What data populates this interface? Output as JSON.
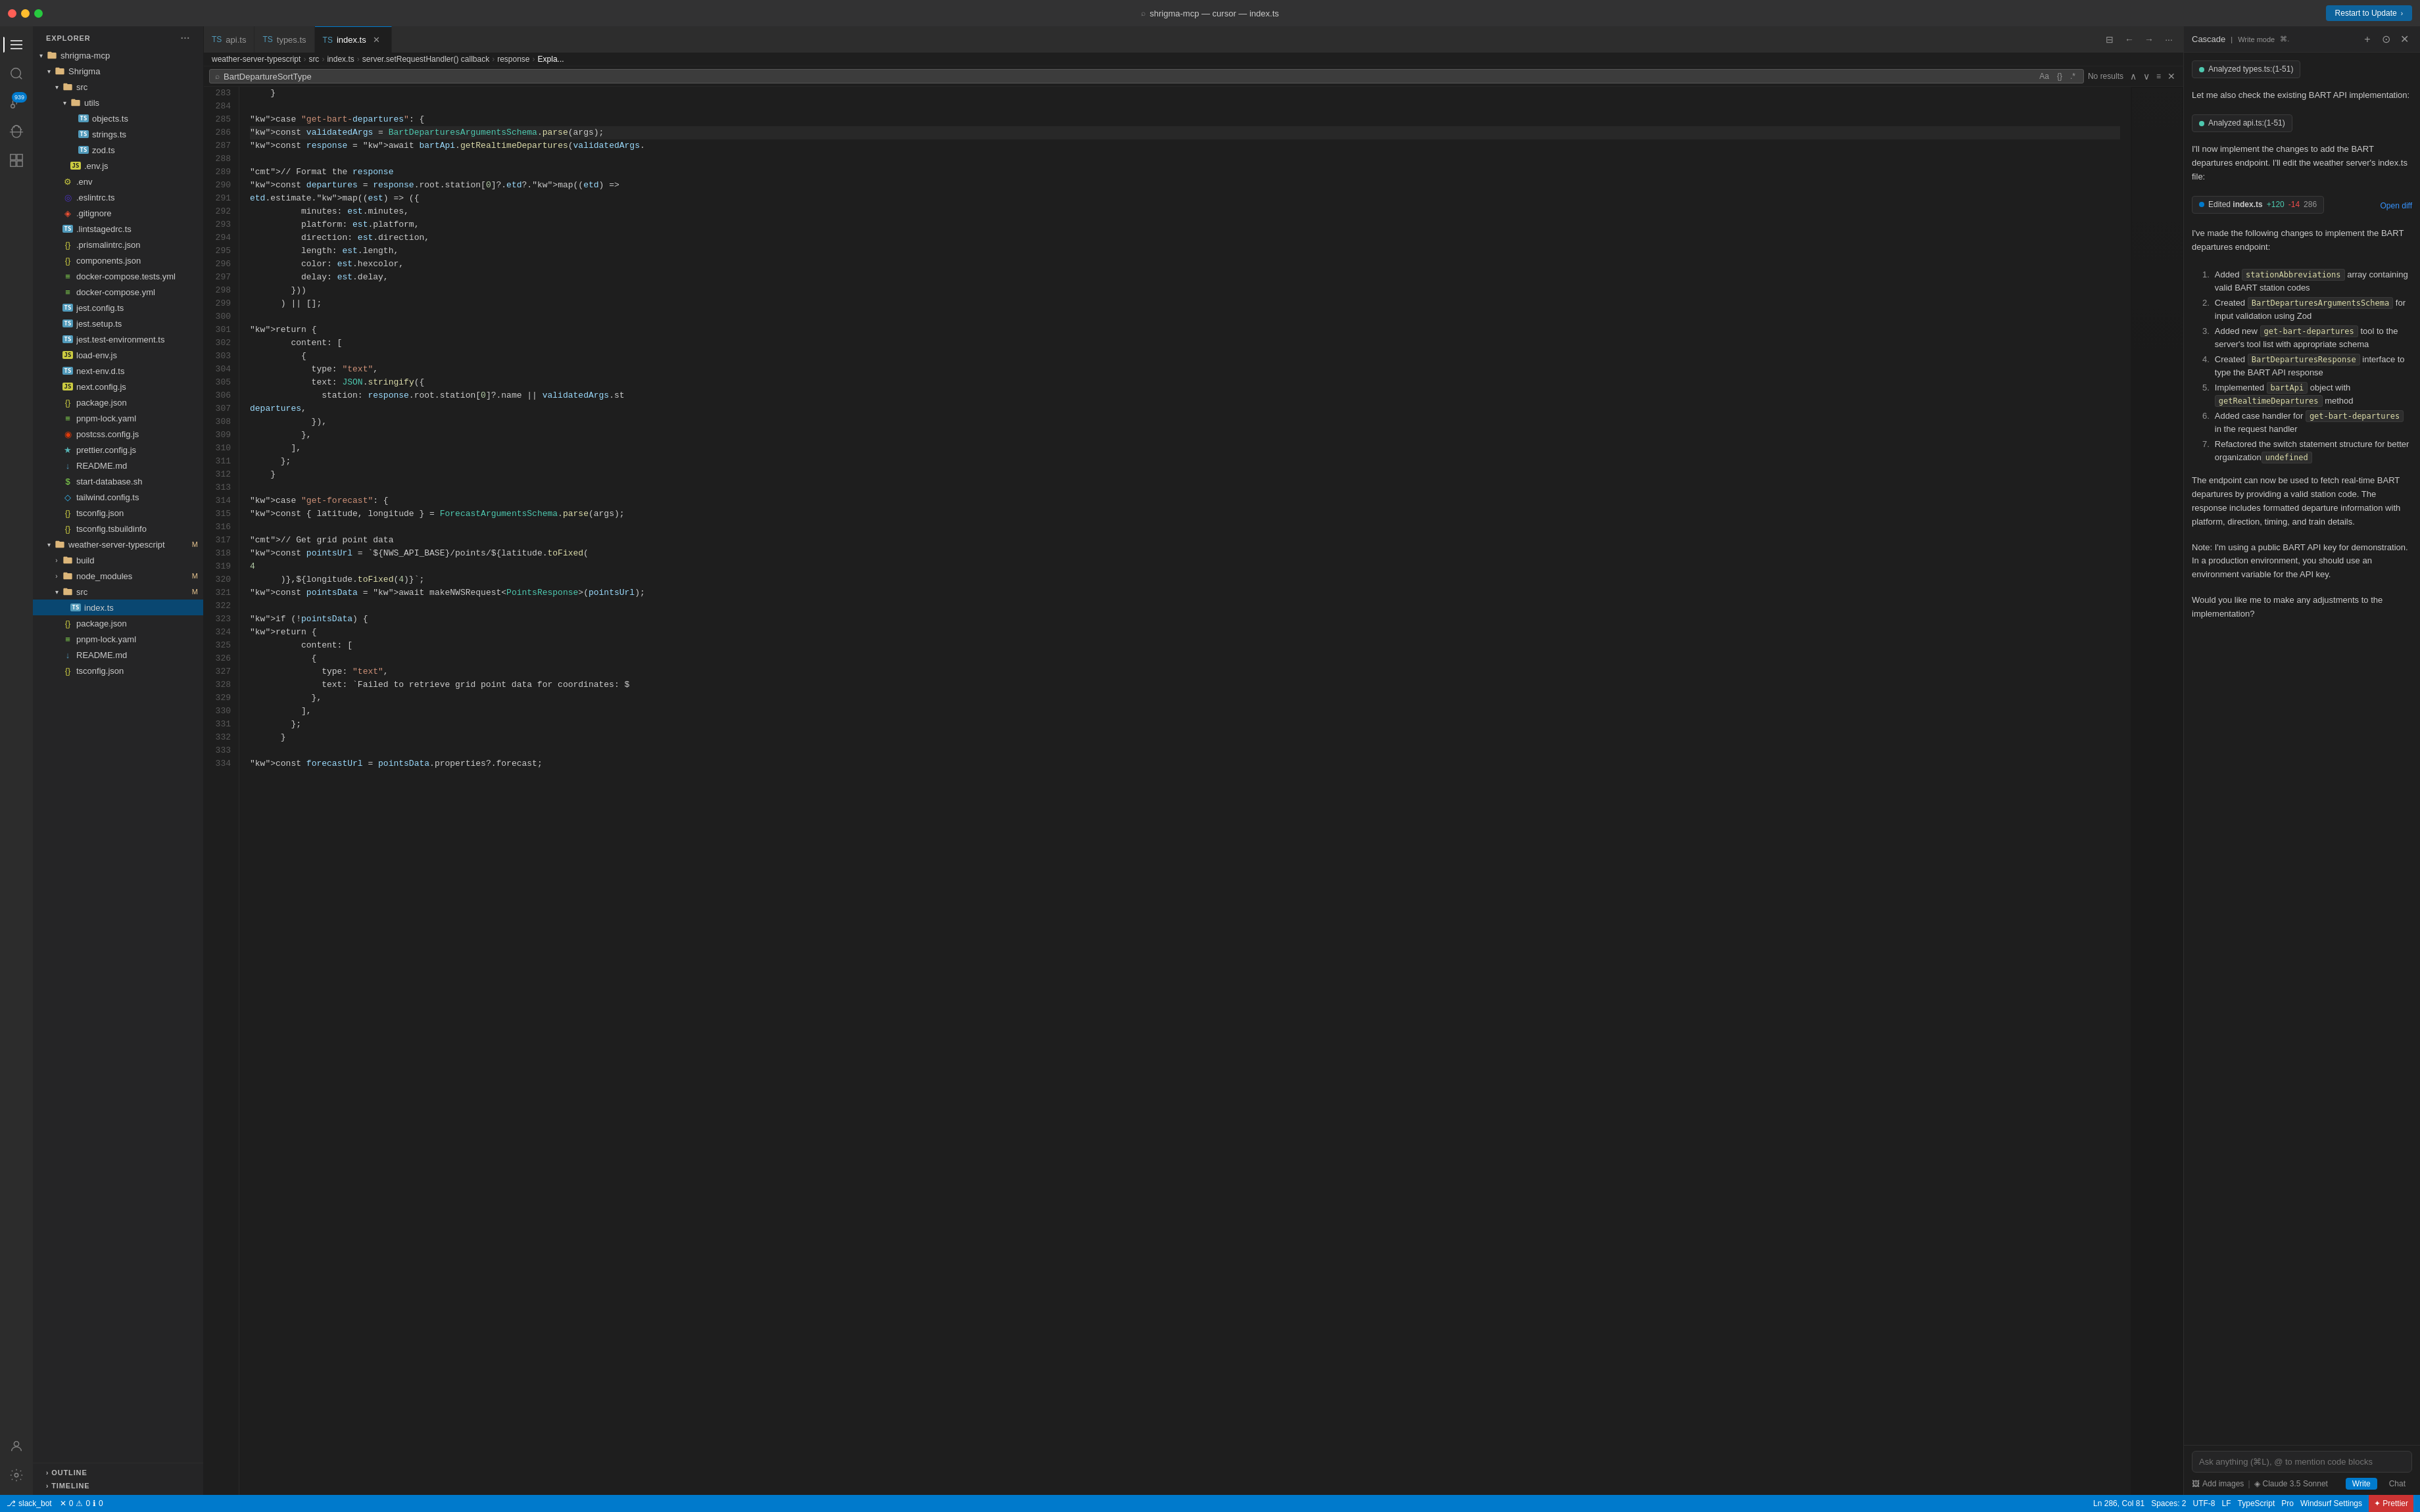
{
  "titleBar": {
    "title": "shrigma-mcp — cursor — index.ts",
    "restartBtn": "Restart to Update"
  },
  "activityBar": {
    "icons": [
      {
        "name": "explorer-icon",
        "symbol": "⎘",
        "active": true
      },
      {
        "name": "search-icon",
        "symbol": "🔍",
        "active": false
      },
      {
        "name": "source-control-icon",
        "symbol": "⎇",
        "active": false,
        "badge": "939"
      },
      {
        "name": "debug-icon",
        "symbol": "▷",
        "active": false
      },
      {
        "name": "extensions-icon",
        "symbol": "⊞",
        "active": false
      },
      {
        "name": "accounts-icon",
        "symbol": "◯",
        "active": false,
        "bottom": true
      },
      {
        "name": "settings-icon",
        "symbol": "⚙",
        "active": false,
        "bottom": true
      }
    ]
  },
  "sidebar": {
    "header": "Explorer",
    "tree": [
      {
        "level": 0,
        "label": "shrigma-mcp",
        "type": "folder",
        "open": true,
        "indent": 0
      },
      {
        "level": 1,
        "label": "Shrigma",
        "type": "folder",
        "open": true,
        "indent": 1
      },
      {
        "level": 2,
        "label": "src",
        "type": "folder-src",
        "open": true,
        "indent": 2
      },
      {
        "level": 3,
        "label": "utils",
        "type": "folder",
        "open": true,
        "indent": 3
      },
      {
        "level": 4,
        "label": "objects.ts",
        "type": "ts",
        "indent": 4
      },
      {
        "level": 4,
        "label": "strings.ts",
        "type": "ts",
        "indent": 4
      },
      {
        "level": 4,
        "label": "zod.ts",
        "type": "ts",
        "indent": 4
      },
      {
        "level": 3,
        "label": ".env.js",
        "type": "js",
        "indent": 3
      },
      {
        "level": 2,
        "label": ".env",
        "type": "env",
        "indent": 2
      },
      {
        "level": 2,
        "label": ".eslintrc.ts",
        "type": "eslint",
        "indent": 2
      },
      {
        "level": 2,
        "label": ".gitignore",
        "type": "git",
        "indent": 2
      },
      {
        "level": 2,
        "label": ".lintstagedrc.ts",
        "type": "ts",
        "indent": 2
      },
      {
        "level": 2,
        "label": ".prismalintrc.json",
        "type": "json",
        "indent": 2
      },
      {
        "level": 2,
        "label": "components.json",
        "type": "json",
        "indent": 2
      },
      {
        "level": 2,
        "label": "docker-compose.tests.yml",
        "type": "yaml",
        "indent": 2
      },
      {
        "level": 2,
        "label": "docker-compose.yml",
        "type": "yaml",
        "indent": 2
      },
      {
        "level": 2,
        "label": "jest.config.ts",
        "type": "ts",
        "indent": 2
      },
      {
        "level": 2,
        "label": "jest.setup.ts",
        "type": "ts",
        "indent": 2
      },
      {
        "level": 2,
        "label": "jest.test-environment.ts",
        "type": "ts",
        "indent": 2
      },
      {
        "level": 2,
        "label": "load-env.js",
        "type": "js",
        "indent": 2
      },
      {
        "level": 2,
        "label": "next-env.d.ts",
        "type": "ts",
        "indent": 2
      },
      {
        "level": 2,
        "label": "next.config.js",
        "type": "js",
        "indent": 2
      },
      {
        "level": 2,
        "label": "package.json",
        "type": "json",
        "indent": 2
      },
      {
        "level": 2,
        "label": "pnpm-lock.yaml",
        "type": "yaml",
        "indent": 2
      },
      {
        "level": 2,
        "label": "postcss.config.js",
        "type": "postcss",
        "indent": 2
      },
      {
        "level": 2,
        "label": "prettier.config.js",
        "type": "prettier",
        "indent": 2
      },
      {
        "level": 2,
        "label": "README.md",
        "type": "md",
        "indent": 2
      },
      {
        "level": 2,
        "label": "start-database.sh",
        "type": "sh",
        "indent": 2
      },
      {
        "level": 2,
        "label": "tailwind.config.ts",
        "type": "tailwind",
        "indent": 2
      },
      {
        "level": 2,
        "label": "tsconfig.json",
        "type": "json",
        "indent": 2
      },
      {
        "level": 2,
        "label": "tsconfig.tsbuildinfo",
        "type": "json",
        "indent": 2
      },
      {
        "level": 1,
        "label": "weather-server-typescript",
        "type": "folder",
        "open": true,
        "indent": 1,
        "gitBadge": "M",
        "gitBadgeType": "orange"
      },
      {
        "level": 2,
        "label": "build",
        "type": "folder",
        "open": false,
        "indent": 2
      },
      {
        "level": 2,
        "label": "node_modules",
        "type": "folder",
        "open": false,
        "indent": 2,
        "gitBadge": "M",
        "gitBadgeType": "orange"
      },
      {
        "level": 2,
        "label": "src",
        "type": "folder-src",
        "open": true,
        "indent": 2,
        "gitBadge": "M",
        "gitBadgeType": "orange"
      },
      {
        "level": 3,
        "label": "index.ts",
        "type": "ts",
        "indent": 3,
        "selected": true
      },
      {
        "level": 2,
        "label": "package.json",
        "type": "json",
        "indent": 2
      },
      {
        "level": 2,
        "label": "pnpm-lock.yaml",
        "type": "yaml",
        "indent": 2
      },
      {
        "level": 2,
        "label": "README.md",
        "type": "md",
        "indent": 2
      },
      {
        "level": 2,
        "label": "tsconfig.json",
        "type": "json",
        "indent": 2
      }
    ],
    "outlineLabel": "Outline",
    "timelineLabel": "Timeline"
  },
  "tabs": [
    {
      "label": "api.ts",
      "type": "ts",
      "active": false,
      "modified": false
    },
    {
      "label": "types.ts",
      "type": "ts",
      "active": false,
      "modified": false
    },
    {
      "label": "index.ts",
      "type": "ts",
      "active": true,
      "modified": false
    }
  ],
  "breadcrumb": {
    "items": [
      "weather-server-typescript",
      "src",
      "index.ts",
      "server.setRequestHandler() callback",
      "response",
      "Expla..."
    ]
  },
  "searchBar": {
    "value": "BartDepartureSortType",
    "noResults": "No results",
    "options": [
      "Aa",
      "{}",
      ".*"
    ]
  },
  "codeLines": [
    {
      "num": 283,
      "content": "    }"
    },
    {
      "num": 284,
      "content": ""
    },
    {
      "num": 285,
      "content": "    case \"get-bart-departures\": {"
    },
    {
      "num": 286,
      "content": "      const validatedArgs = BartDeparturesArgumentsSchema.parse(args);"
    },
    {
      "num": 287,
      "content": "      const response = await bartApi.getRealtimeDepartures(validatedArgs."
    },
    {
      "num": 288,
      "content": ""
    },
    {
      "num": 289,
      "content": "      // Format the response"
    },
    {
      "num": 290,
      "content": "      const departures = response.root.station[0]?.etd?.map((etd) =>"
    },
    {
      "num": 291,
      "content": "        etd.estimate.map((est) => ({"
    },
    {
      "num": 292,
      "content": "          minutes: est.minutes,"
    },
    {
      "num": 293,
      "content": "          platform: est.platform,"
    },
    {
      "num": 294,
      "content": "          direction: est.direction,"
    },
    {
      "num": 295,
      "content": "          length: est.length,"
    },
    {
      "num": 296,
      "content": "          color: est.hexcolor,"
    },
    {
      "num": 297,
      "content": "          delay: est.delay,"
    },
    {
      "num": 298,
      "content": "        }))"
    },
    {
      "num": 299,
      "content": "      ) || [];"
    },
    {
      "num": 300,
      "content": ""
    },
    {
      "num": 301,
      "content": "      return {"
    },
    {
      "num": 302,
      "content": "        content: ["
    },
    {
      "num": 303,
      "content": "          {"
    },
    {
      "num": 304,
      "content": "            type: \"text\","
    },
    {
      "num": 305,
      "content": "            text: JSON.stringify({"
    },
    {
      "num": 306,
      "content": "              station: response.root.station[0]?.name || validatedArgs.st"
    },
    {
      "num": 307,
      "content": "              departures,"
    },
    {
      "num": 308,
      "content": "            }),"
    },
    {
      "num": 309,
      "content": "          },"
    },
    {
      "num": 310,
      "content": "        ],"
    },
    {
      "num": 311,
      "content": "      };"
    },
    {
      "num": 312,
      "content": "    }"
    },
    {
      "num": 313,
      "content": ""
    },
    {
      "num": 314,
      "content": "    case \"get-forecast\": {"
    },
    {
      "num": 315,
      "content": "      const { latitude, longitude } = ForecastArgumentsSchema.parse(args);"
    },
    {
      "num": 316,
      "content": ""
    },
    {
      "num": 317,
      "content": "      // Get grid point data"
    },
    {
      "num": 318,
      "content": "      const pointsUrl = `${NWS_API_BASE}/points/${latitude.toFixed("
    },
    {
      "num": 319,
      "content": "        4"
    },
    {
      "num": 320,
      "content": "      )},${longitude.toFixed(4)}`;"
    },
    {
      "num": 321,
      "content": "      const pointsData = await makeNWSRequest<PointsResponse>(pointsUrl);"
    },
    {
      "num": 322,
      "content": ""
    },
    {
      "num": 323,
      "content": "      if (!pointsData) {"
    },
    {
      "num": 324,
      "content": "        return {"
    },
    {
      "num": 325,
      "content": "          content: ["
    },
    {
      "num": 326,
      "content": "            {"
    },
    {
      "num": 327,
      "content": "              type: \"text\","
    },
    {
      "num": 328,
      "content": "              text: `Failed to retrieve grid point data for coordinates: $"
    },
    {
      "num": 329,
      "content": "            },"
    },
    {
      "num": 330,
      "content": "          ],"
    },
    {
      "num": 331,
      "content": "        };"
    },
    {
      "num": 332,
      "content": "      }"
    },
    {
      "num": 333,
      "content": ""
    },
    {
      "num": 334,
      "content": "      const forecastUrl = pointsData.properties?.forecast;"
    }
  ],
  "chat": {
    "header": {
      "title": "Cascade",
      "mode": "Write mode",
      "shortcut": "⌘."
    },
    "messages": [
      {
        "type": "analyzed",
        "label": "Analyzed  types.ts:(1-51)"
      },
      {
        "type": "text",
        "content": "Let me also check the existing BART API implementation:"
      },
      {
        "type": "analyzed",
        "label": "Analyzed  api.ts:(1-51)"
      },
      {
        "type": "text",
        "content": "I'll now implement the changes to add the BART departures endpoint. I'll edit the weather server's index.ts file:"
      },
      {
        "type": "edited",
        "file": "index.ts",
        "add": "+120",
        "del": "-14",
        "total": "286",
        "openDiff": "Open diff"
      },
      {
        "type": "text",
        "content": "I've made the following changes to implement the BART departures endpoint:"
      },
      {
        "type": "list",
        "items": [
          {
            "num": "1.",
            "text": "Added ",
            "code": "stationAbbreviations",
            "rest": " array containing valid BART station codes"
          },
          {
            "num": "2.",
            "text": "Created ",
            "code": "BartDeparturesArgumentsSchema",
            "rest": " for input validation using Zod"
          },
          {
            "num": "3.",
            "text": "Added new ",
            "code": "get-bart-departures",
            "rest": " tool to the server's tool list with appropriate schema"
          },
          {
            "num": "4.",
            "text": "Created ",
            "code": "BartDeparturesResponse",
            "rest": " interface to type the BART API response"
          },
          {
            "num": "5.",
            "text": "Implemented ",
            "code": "bartApi",
            "rest": " object with ",
            "code2": "getRealtimeDepartures",
            "rest2": " method"
          },
          {
            "num": "6.",
            "text": "Added case handler for ",
            "code": "get-bart-departures",
            "rest": " in the request handler"
          },
          {
            "num": "7.",
            "text": "Refactored the switch statement structure for better organization"
          }
        ]
      },
      {
        "type": "text",
        "content": "The endpoint can now be used to fetch real-time BART departures by providing a valid station code. The response includes formatted departure information with platform, direction, timing, and train details."
      },
      {
        "type": "text",
        "content": "Note: I'm using a public BART API key for demonstration. In a production environment, you should use an environment variable for the API key."
      },
      {
        "type": "text",
        "content": "Would you like me to make any adjustments to the implementation?"
      }
    ],
    "inputPlaceholder": "Ask anything (⌘L), @ to mention code blocks",
    "addImages": "Add images",
    "claudeLabel": "Claude 3.5 Sonnet",
    "writeBtn": "Write",
    "chatBtn": "Chat"
  },
  "statusBar": {
    "branch": "slack_bot",
    "errors": "0",
    "warnings": "0",
    "info": "0",
    "position": "Ln 286, Col 81",
    "spaces": "Spaces: 2",
    "encoding": "UTF-8",
    "lineEnding": "LF",
    "language": "TypeScript",
    "mode": "Pro",
    "settings": "Windsurf Settings",
    "prettier": "✦ Prettier"
  }
}
